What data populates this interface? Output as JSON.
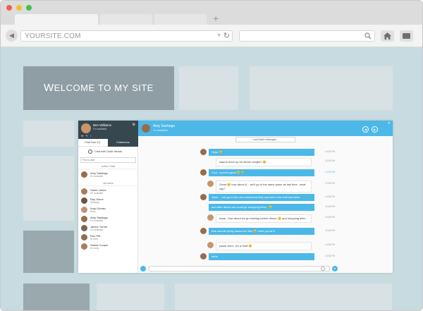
{
  "browser": {
    "url": "YOURSITE.COM",
    "new_tab_symbol": "+"
  },
  "page": {
    "welcome_parts": {
      "w": "W",
      "elcome": "ELCOME",
      "to": "TO",
      "my": "MY",
      "site": "SITE"
    }
  },
  "chat": {
    "me": {
      "name": "Ben Williams",
      "status": "I'm available"
    },
    "tabs": {
      "chat_now": "Chat Now (7)",
      "chatrooms": "Chatrooms"
    },
    "friends_label": "Chat with OnAir friends",
    "find_placeholder": "Find a user",
    "active_title": "Active Chats",
    "all_title": "All Users",
    "active_users": [
      {
        "name": "Amy Santiago",
        "status": "I'm available",
        "color": "#9a6b4b"
      }
    ],
    "all_users": [
      {
        "name": "Sarah Jones",
        "status": "I'm available",
        "color": "#b07a58"
      },
      {
        "name": "Ray Stone",
        "status": "Sleeping",
        "color": "#6d5444"
      },
      {
        "name": "Katy Gomez",
        "status": "Busy",
        "color": "#c59276"
      },
      {
        "name": "Amy Santiago",
        "status": "I'm available",
        "color": "#9a6b4b"
      },
      {
        "name": "James Turner",
        "status": "I'm available",
        "color": "#7b634f"
      },
      {
        "name": "Ron Pitt",
        "status": "At work",
        "color": "#8c6d57"
      },
      {
        "name": "Sasha Cooper",
        "status": "I'm busy",
        "color": "#a87b61"
      }
    ],
    "conversation": {
      "name": "Amy Santiago",
      "status": "I'm available",
      "load_earlier": "Load Earlier Messages...",
      "messages": [
        {
          "text": "Heya 😊",
          "time": "12:04 PM"
        },
        {
          "text": "wanna meet up for dinner tonight? 😊",
          "time": "12:04 PM"
        },
        {
          "text": "Cool...sounds great 😊 😂",
          "time": "12:04 PM"
        },
        {
          "text": "Great 😊 how about 8... we'll go to the same place as last time...what say?",
          "time": "12:05 PM"
        },
        {
          "text": "Yeah.... lets go to the new restaurant they opened in the mall last week",
          "time": "12:05 PM"
        },
        {
          "text": "and after dinner we could go shopping hehe.. 😊",
          "time": "12:05 PM"
        },
        {
          "text": "haaa.. how about we go bowling before dinner 😊 and shopping after..",
          "time": "12:06 PM"
        },
        {
          "text": "that sounds pretty awesome Ben 😊 meet you at 8",
          "time": "12:06 PM"
        },
        {
          "text": "yaaar..then...it's a Date 😊",
          "time": "12:06 PM"
        },
        {
          "text": "hehe",
          "time": "12:06 PM"
        }
      ]
    }
  },
  "colors": {
    "accent": "#4bb8e8",
    "dark_header": "#37474f",
    "page_bg": "#c8dbe0"
  }
}
